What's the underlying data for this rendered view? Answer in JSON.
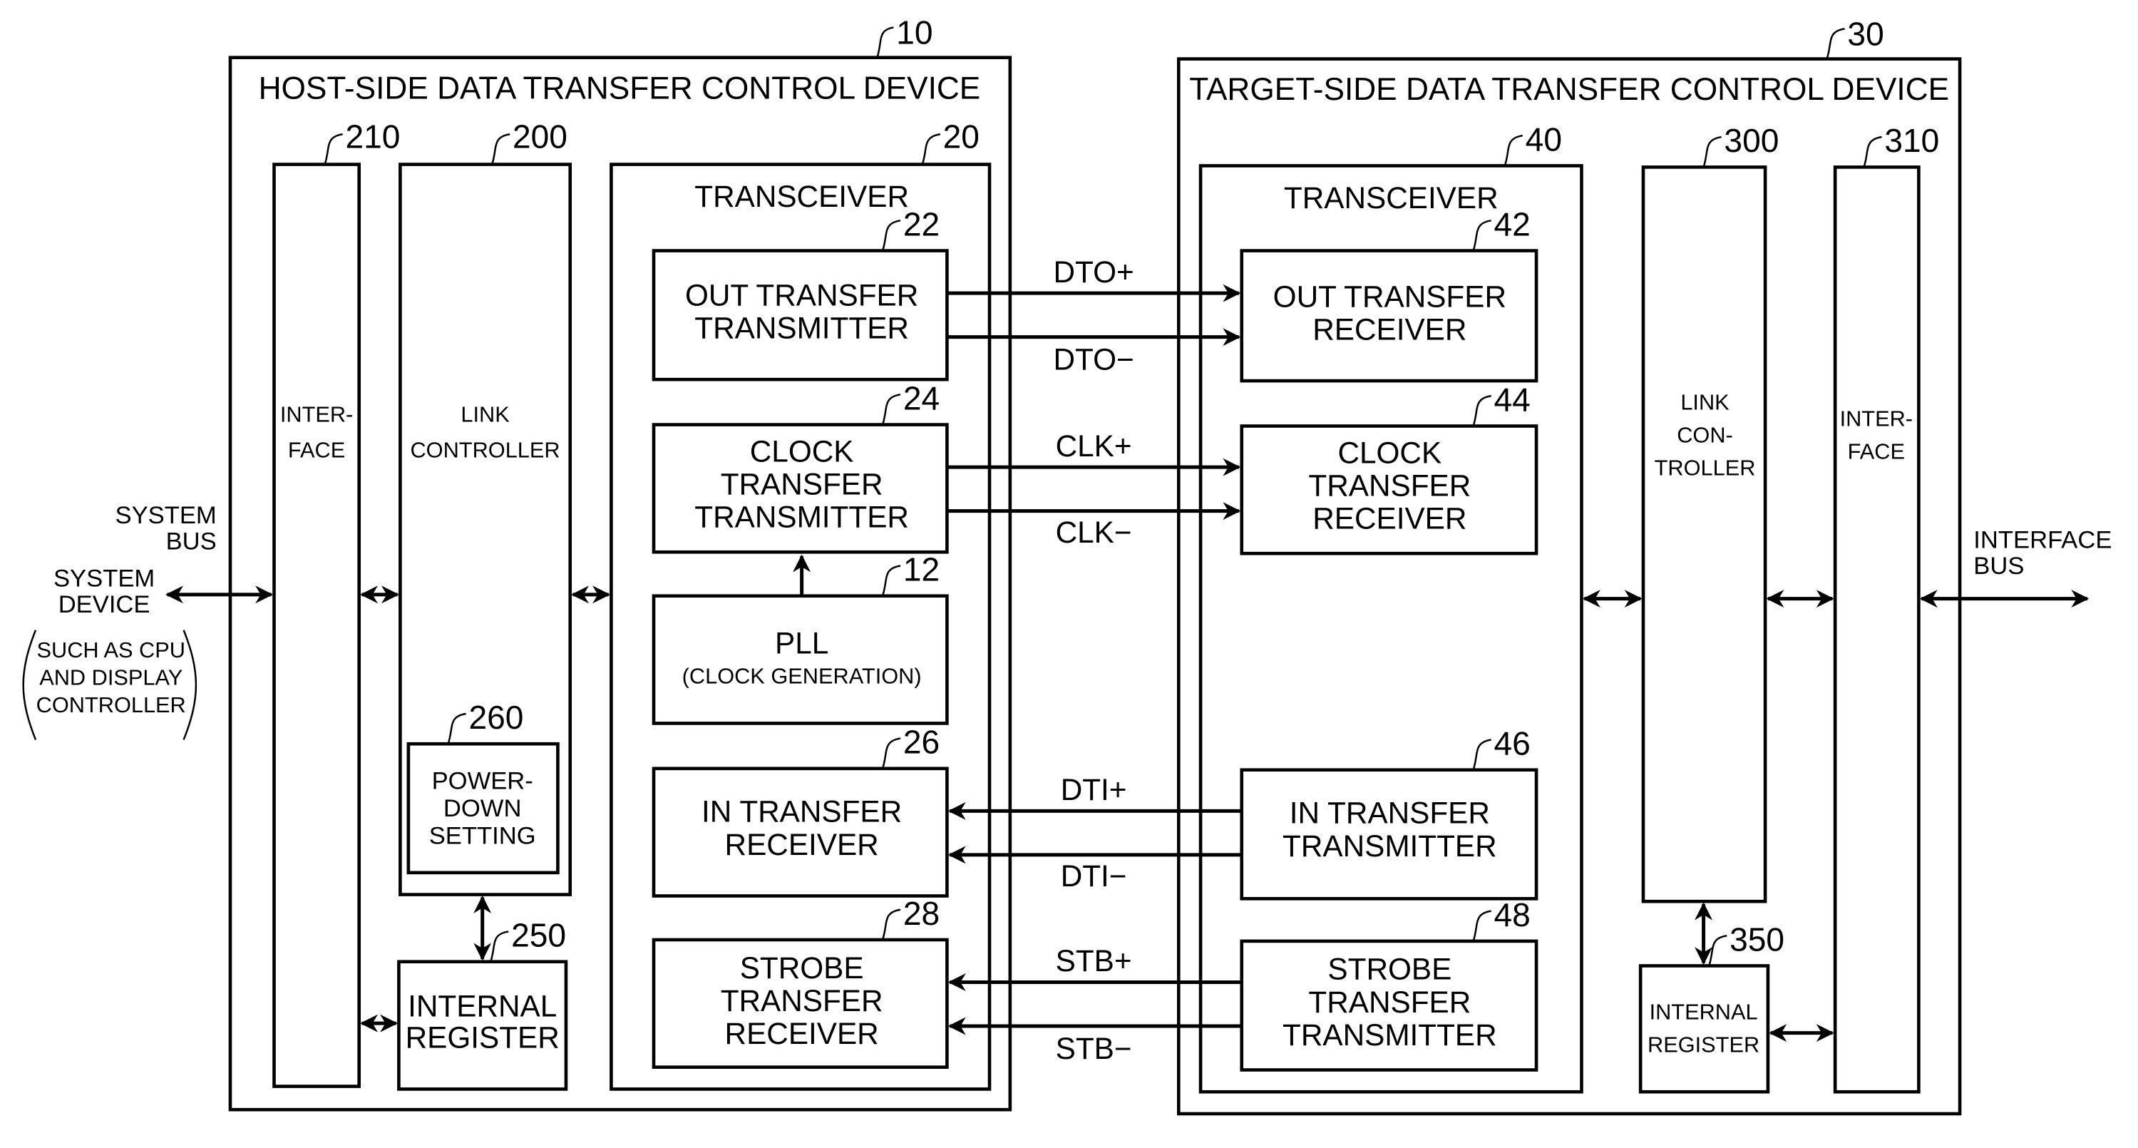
{
  "figure": {
    "host": {
      "ref": "10",
      "title": "HOST-SIDE DATA TRANSFER CONTROL DEVICE",
      "interface": {
        "ref": "210",
        "lines": [
          "INTER-",
          "FACE"
        ]
      },
      "link_controller": {
        "ref": "200",
        "lines": [
          "LINK",
          "CONTROLLER"
        ]
      },
      "power_down": {
        "ref": "260",
        "lines": [
          "POWER-",
          "DOWN",
          "SETTING"
        ]
      },
      "internal_register": {
        "ref": "250",
        "lines": [
          "INTERNAL",
          "REGISTER"
        ]
      },
      "transceiver": {
        "ref": "20",
        "title": "TRANSCEIVER",
        "out_tx": {
          "ref": "22",
          "lines": [
            "OUT TRANSFER",
            "TRANSMITTER"
          ]
        },
        "clk_tx": {
          "ref": "24",
          "lines": [
            "CLOCK",
            "TRANSFER",
            "TRANSMITTER"
          ]
        },
        "pll": {
          "ref": "12",
          "lines": [
            "PLL",
            "(CLOCK GENERATION)"
          ]
        },
        "in_rx": {
          "ref": "26",
          "lines": [
            "IN TRANSFER",
            "RECEIVER"
          ]
        },
        "stb_rx": {
          "ref": "28",
          "lines": [
            "STROBE",
            "TRANSFER",
            "RECEIVER"
          ]
        }
      }
    },
    "target": {
      "ref": "30",
      "title": "TARGET-SIDE DATA TRANSFER CONTROL DEVICE",
      "transceiver": {
        "ref": "40",
        "title": "TRANSCEIVER",
        "out_rx": {
          "ref": "42",
          "lines": [
            "OUT TRANSFER",
            "RECEIVER"
          ]
        },
        "clk_rx": {
          "ref": "44",
          "lines": [
            "CLOCK",
            "TRANSFER",
            "RECEIVER"
          ]
        },
        "in_tx": {
          "ref": "46",
          "lines": [
            "IN TRANSFER",
            "TRANSMITTER"
          ]
        },
        "stb_tx": {
          "ref": "48",
          "lines": [
            "STROBE",
            "TRANSFER",
            "TRANSMITTER"
          ]
        }
      },
      "link_controller": {
        "ref": "300",
        "lines": [
          "LINK",
          "CON-",
          "TROLLER"
        ]
      },
      "interface": {
        "ref": "310",
        "lines": [
          "INTER-",
          "FACE"
        ]
      },
      "internal_register": {
        "ref": "350",
        "lines": [
          "INTERNAL",
          "REGISTER"
        ]
      }
    },
    "signals": {
      "dto_plus": "DTO+",
      "dto_minus": "DTO−",
      "clk_plus": "CLK+",
      "clk_minus": "CLK−",
      "dti_plus": "DTI+",
      "dti_minus": "DTI−",
      "stb_plus": "STB+",
      "stb_minus": "STB−"
    },
    "external": {
      "system_bus": [
        "SYSTEM",
        "BUS"
      ],
      "system_device": [
        "SYSTEM",
        "DEVICE"
      ],
      "system_device_note": [
        "SUCH AS CPU",
        "AND DISPLAY",
        "CONTROLLER"
      ],
      "interface_bus": [
        "INTERFACE",
        "BUS"
      ]
    }
  }
}
